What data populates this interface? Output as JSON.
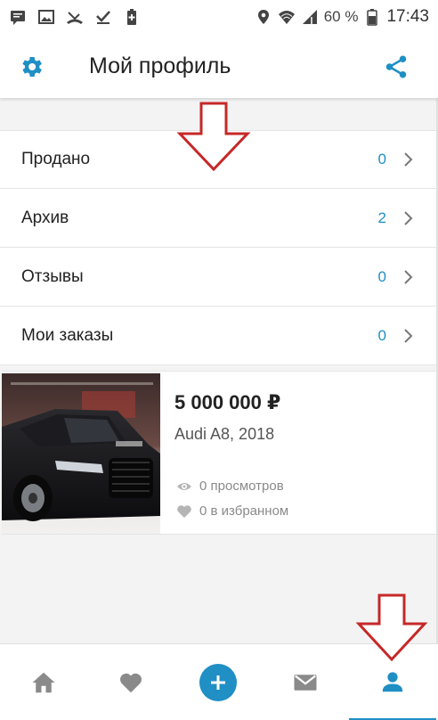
{
  "status_bar": {
    "battery_percent": "60 %",
    "time": "17:43"
  },
  "header": {
    "title": "Мой профиль"
  },
  "menu": [
    {
      "label": "Продано",
      "count": "0"
    },
    {
      "label": "Архив",
      "count": "2"
    },
    {
      "label": "Отзывы",
      "count": "0"
    },
    {
      "label": "Мои заказы",
      "count": "0"
    }
  ],
  "listing": {
    "price": "5 000 000 ₽",
    "model": "Audi A8, 2018",
    "views": "0 просмотров",
    "favorites": "0 в избранном"
  },
  "bottom_nav": {
    "items": [
      "home-icon",
      "favorites-icon",
      "add-icon",
      "messages-icon",
      "profile-icon"
    ],
    "active": "profile-icon"
  },
  "colors": {
    "accent": "#1f8fc4",
    "annotation_arrow": "#c62828"
  }
}
